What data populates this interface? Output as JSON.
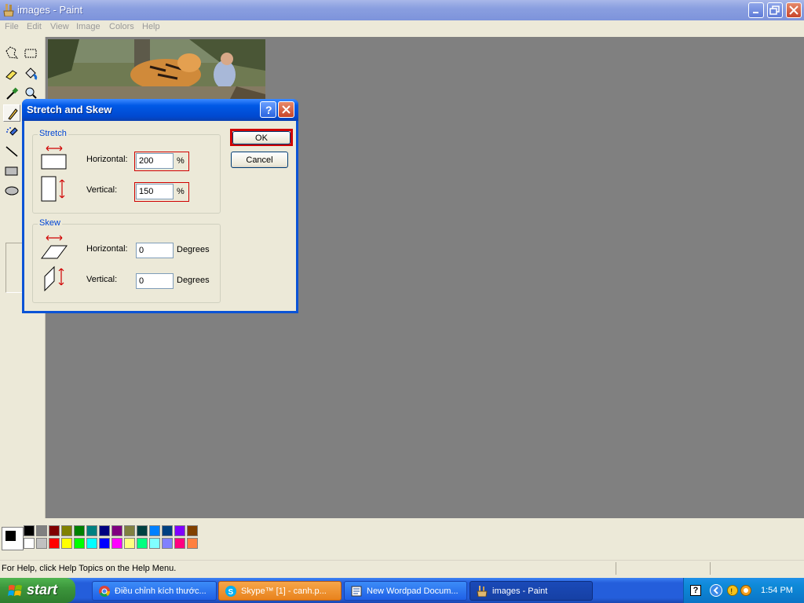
{
  "window": {
    "title": "images - Paint"
  },
  "menu": [
    "File",
    "Edit",
    "View",
    "Image",
    "Colors",
    "Help"
  ],
  "status": {
    "text": "For Help, click Help Topics on the Help Menu."
  },
  "dialog": {
    "title": "Stretch and Skew",
    "stretch": {
      "legend": "Stretch",
      "horizontal_label": "Horizontal:",
      "horizontal_value": "200",
      "horizontal_unit": "%",
      "vertical_label": "Vertical:",
      "vertical_value": "150",
      "vertical_unit": "%"
    },
    "skew": {
      "legend": "Skew",
      "horizontal_label": "Horizontal:",
      "horizontal_value": "0",
      "horizontal_unit": "Degrees",
      "vertical_label": "Vertical:",
      "vertical_value": "0",
      "vertical_unit": "Degrees"
    },
    "ok_label": "OK",
    "cancel_label": "Cancel"
  },
  "palette": {
    "row1": [
      "#000000",
      "#808080",
      "#800000",
      "#808000",
      "#008000",
      "#008080",
      "#000080",
      "#800080",
      "#808040",
      "#004040",
      "#0080ff",
      "#004080",
      "#8000ff",
      "#804000"
    ],
    "row2": [
      "#ffffff",
      "#c0c0c0",
      "#ff0000",
      "#ffff00",
      "#00ff00",
      "#00ffff",
      "#0000ff",
      "#ff00ff",
      "#ffff80",
      "#00ff80",
      "#80ffff",
      "#8080ff",
      "#ff0080",
      "#ff8040"
    ]
  },
  "taskbar": {
    "start": "start",
    "tasks": [
      {
        "label": "Điều chỉnh kích thước...",
        "icon": "chrome-icon"
      },
      {
        "label": "Skype™ [1] - canh.p...",
        "icon": "skype-icon"
      },
      {
        "label": "New Wordpad Docum...",
        "icon": "wordpad-icon"
      },
      {
        "label": "images - Paint",
        "icon": "paint-icon"
      }
    ],
    "clock": "1:54 PM"
  }
}
